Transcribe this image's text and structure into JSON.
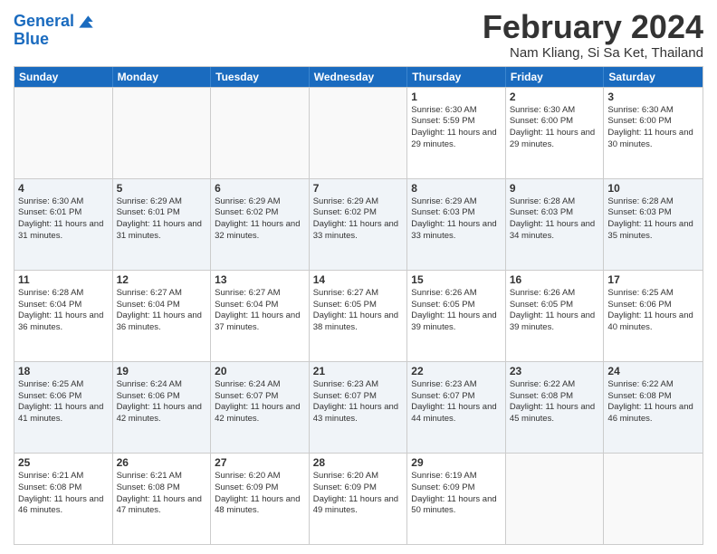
{
  "header": {
    "logo_line1": "General",
    "logo_line2": "Blue",
    "month": "February 2024",
    "location": "Nam Kliang, Si Sa Ket, Thailand"
  },
  "days_of_week": [
    "Sunday",
    "Monday",
    "Tuesday",
    "Wednesday",
    "Thursday",
    "Friday",
    "Saturday"
  ],
  "weeks": [
    [
      {
        "day": "",
        "sunrise": "",
        "sunset": "",
        "daylight": ""
      },
      {
        "day": "",
        "sunrise": "",
        "sunset": "",
        "daylight": ""
      },
      {
        "day": "",
        "sunrise": "",
        "sunset": "",
        "daylight": ""
      },
      {
        "day": "",
        "sunrise": "",
        "sunset": "",
        "daylight": ""
      },
      {
        "day": "1",
        "sunrise": "Sunrise: 6:30 AM",
        "sunset": "Sunset: 5:59 PM",
        "daylight": "Daylight: 11 hours and 29 minutes."
      },
      {
        "day": "2",
        "sunrise": "Sunrise: 6:30 AM",
        "sunset": "Sunset: 6:00 PM",
        "daylight": "Daylight: 11 hours and 29 minutes."
      },
      {
        "day": "3",
        "sunrise": "Sunrise: 6:30 AM",
        "sunset": "Sunset: 6:00 PM",
        "daylight": "Daylight: 11 hours and 30 minutes."
      }
    ],
    [
      {
        "day": "4",
        "sunrise": "Sunrise: 6:30 AM",
        "sunset": "Sunset: 6:01 PM",
        "daylight": "Daylight: 11 hours and 31 minutes."
      },
      {
        "day": "5",
        "sunrise": "Sunrise: 6:29 AM",
        "sunset": "Sunset: 6:01 PM",
        "daylight": "Daylight: 11 hours and 31 minutes."
      },
      {
        "day": "6",
        "sunrise": "Sunrise: 6:29 AM",
        "sunset": "Sunset: 6:02 PM",
        "daylight": "Daylight: 11 hours and 32 minutes."
      },
      {
        "day": "7",
        "sunrise": "Sunrise: 6:29 AM",
        "sunset": "Sunset: 6:02 PM",
        "daylight": "Daylight: 11 hours and 33 minutes."
      },
      {
        "day": "8",
        "sunrise": "Sunrise: 6:29 AM",
        "sunset": "Sunset: 6:03 PM",
        "daylight": "Daylight: 11 hours and 33 minutes."
      },
      {
        "day": "9",
        "sunrise": "Sunrise: 6:28 AM",
        "sunset": "Sunset: 6:03 PM",
        "daylight": "Daylight: 11 hours and 34 minutes."
      },
      {
        "day": "10",
        "sunrise": "Sunrise: 6:28 AM",
        "sunset": "Sunset: 6:03 PM",
        "daylight": "Daylight: 11 hours and 35 minutes."
      }
    ],
    [
      {
        "day": "11",
        "sunrise": "Sunrise: 6:28 AM",
        "sunset": "Sunset: 6:04 PM",
        "daylight": "Daylight: 11 hours and 36 minutes."
      },
      {
        "day": "12",
        "sunrise": "Sunrise: 6:27 AM",
        "sunset": "Sunset: 6:04 PM",
        "daylight": "Daylight: 11 hours and 36 minutes."
      },
      {
        "day": "13",
        "sunrise": "Sunrise: 6:27 AM",
        "sunset": "Sunset: 6:04 PM",
        "daylight": "Daylight: 11 hours and 37 minutes."
      },
      {
        "day": "14",
        "sunrise": "Sunrise: 6:27 AM",
        "sunset": "Sunset: 6:05 PM",
        "daylight": "Daylight: 11 hours and 38 minutes."
      },
      {
        "day": "15",
        "sunrise": "Sunrise: 6:26 AM",
        "sunset": "Sunset: 6:05 PM",
        "daylight": "Daylight: 11 hours and 39 minutes."
      },
      {
        "day": "16",
        "sunrise": "Sunrise: 6:26 AM",
        "sunset": "Sunset: 6:05 PM",
        "daylight": "Daylight: 11 hours and 39 minutes."
      },
      {
        "day": "17",
        "sunrise": "Sunrise: 6:25 AM",
        "sunset": "Sunset: 6:06 PM",
        "daylight": "Daylight: 11 hours and 40 minutes."
      }
    ],
    [
      {
        "day": "18",
        "sunrise": "Sunrise: 6:25 AM",
        "sunset": "Sunset: 6:06 PM",
        "daylight": "Daylight: 11 hours and 41 minutes."
      },
      {
        "day": "19",
        "sunrise": "Sunrise: 6:24 AM",
        "sunset": "Sunset: 6:06 PM",
        "daylight": "Daylight: 11 hours and 42 minutes."
      },
      {
        "day": "20",
        "sunrise": "Sunrise: 6:24 AM",
        "sunset": "Sunset: 6:07 PM",
        "daylight": "Daylight: 11 hours and 42 minutes."
      },
      {
        "day": "21",
        "sunrise": "Sunrise: 6:23 AM",
        "sunset": "Sunset: 6:07 PM",
        "daylight": "Daylight: 11 hours and 43 minutes."
      },
      {
        "day": "22",
        "sunrise": "Sunrise: 6:23 AM",
        "sunset": "Sunset: 6:07 PM",
        "daylight": "Daylight: 11 hours and 44 minutes."
      },
      {
        "day": "23",
        "sunrise": "Sunrise: 6:22 AM",
        "sunset": "Sunset: 6:08 PM",
        "daylight": "Daylight: 11 hours and 45 minutes."
      },
      {
        "day": "24",
        "sunrise": "Sunrise: 6:22 AM",
        "sunset": "Sunset: 6:08 PM",
        "daylight": "Daylight: 11 hours and 46 minutes."
      }
    ],
    [
      {
        "day": "25",
        "sunrise": "Sunrise: 6:21 AM",
        "sunset": "Sunset: 6:08 PM",
        "daylight": "Daylight: 11 hours and 46 minutes."
      },
      {
        "day": "26",
        "sunrise": "Sunrise: 6:21 AM",
        "sunset": "Sunset: 6:08 PM",
        "daylight": "Daylight: 11 hours and 47 minutes."
      },
      {
        "day": "27",
        "sunrise": "Sunrise: 6:20 AM",
        "sunset": "Sunset: 6:09 PM",
        "daylight": "Daylight: 11 hours and 48 minutes."
      },
      {
        "day": "28",
        "sunrise": "Sunrise: 6:20 AM",
        "sunset": "Sunset: 6:09 PM",
        "daylight": "Daylight: 11 hours and 49 minutes."
      },
      {
        "day": "29",
        "sunrise": "Sunrise: 6:19 AM",
        "sunset": "Sunset: 6:09 PM",
        "daylight": "Daylight: 11 hours and 50 minutes."
      },
      {
        "day": "",
        "sunrise": "",
        "sunset": "",
        "daylight": ""
      },
      {
        "day": "",
        "sunrise": "",
        "sunset": "",
        "daylight": ""
      }
    ]
  ]
}
